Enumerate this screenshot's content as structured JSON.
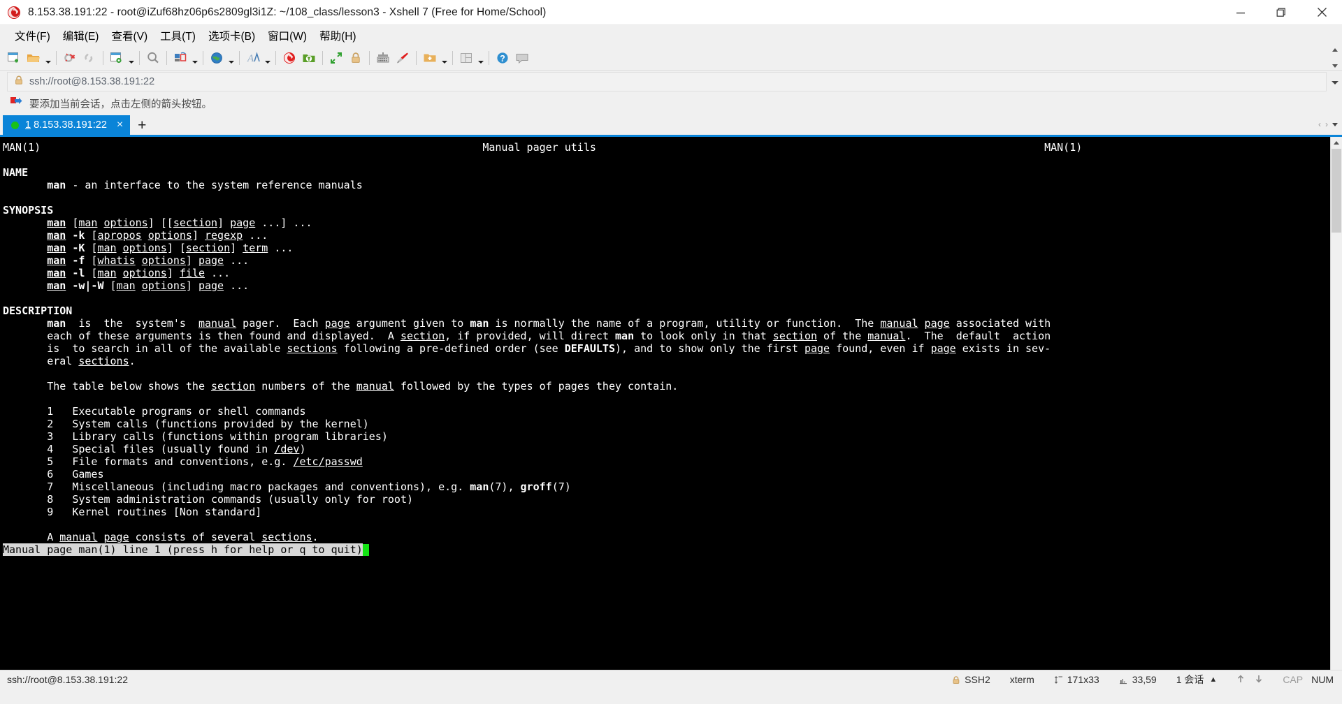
{
  "window": {
    "title": "8.153.38.191:22 - root@iZuf68hz06p6s2809gl3i1Z: ~/108_class/lesson3 - Xshell 7 (Free for Home/School)",
    "logo_icon": "xshell-logo-icon",
    "minimize_label": "Minimize",
    "maximize_label": "Restore",
    "close_label": "Close"
  },
  "menubar": {
    "items": [
      {
        "label": "文件(F)",
        "name": "menu-file"
      },
      {
        "label": "编辑(E)",
        "name": "menu-edit"
      },
      {
        "label": "查看(V)",
        "name": "menu-view"
      },
      {
        "label": "工具(T)",
        "name": "menu-tools"
      },
      {
        "label": "选项卡(B)",
        "name": "menu-tabs"
      },
      {
        "label": "窗口(W)",
        "name": "menu-window"
      },
      {
        "label": "帮助(H)",
        "name": "menu-help"
      }
    ]
  },
  "toolbar": {
    "buttons": [
      {
        "name": "new-session-icon",
        "tooltip": "新建"
      },
      {
        "name": "open-folder-icon",
        "tooltip": "打开"
      },
      {
        "name": "disconnect-icon",
        "tooltip": "断开"
      },
      {
        "name": "reconnect-icon",
        "tooltip": "重新连接"
      },
      {
        "name": "session-properties-icon",
        "tooltip": "属性"
      },
      {
        "name": "find-icon",
        "tooltip": "查找"
      },
      {
        "name": "layout-icon",
        "tooltip": "排列"
      },
      {
        "name": "globe-icon",
        "tooltip": "编码"
      },
      {
        "name": "font-icon",
        "tooltip": "字体"
      },
      {
        "name": "xshell-icon",
        "tooltip": "Xshell"
      },
      {
        "name": "xftp-icon",
        "tooltip": "Xftp"
      },
      {
        "name": "fullscreen-icon",
        "tooltip": "全屏"
      },
      {
        "name": "lock-icon",
        "tooltip": "锁定"
      },
      {
        "name": "keyboard-icon",
        "tooltip": "键盘"
      },
      {
        "name": "highlight-icon",
        "tooltip": "高亮"
      },
      {
        "name": "add-folder-icon",
        "tooltip": "添加"
      },
      {
        "name": "panes-icon",
        "tooltip": "窗格"
      },
      {
        "name": "help-icon",
        "tooltip": "帮助"
      },
      {
        "name": "feedback-icon",
        "tooltip": "反馈"
      }
    ]
  },
  "address_bar": {
    "value": "ssh://root@8.153.38.191:22",
    "lock_icon": "lock-icon",
    "dropdown_icon": "chevron-down-icon"
  },
  "notice": {
    "text": "要添加当前会话，点击左侧的箭头按钮。",
    "icon": "red-arrow-flag-icon"
  },
  "tabs": {
    "items": [
      {
        "number": "1",
        "label": "8.153.38.191:22",
        "status": "connected",
        "close_label": "×"
      }
    ],
    "add_label": "+",
    "scroll_left": "‹",
    "scroll_right": "›"
  },
  "terminal": {
    "header_left": "MAN(1)",
    "header_center": "Manual pager utils",
    "header_right": "MAN(1)",
    "sections": {
      "name_heading": "NAME",
      "name_body": "man - an interface to the system reference manuals",
      "synopsis_heading": "SYNOPSIS",
      "synopsis_lines": [
        "man [man options] [[section] page ...] ...",
        "man -k [apropos options] regexp ...",
        "man -K [man options] [section] term ...",
        "man -f [whatis options] page ...",
        "man -l [man options] file ...",
        "man -w|-W [man options] page ..."
      ],
      "description_heading": "DESCRIPTION",
      "description_paragraph_lines": [
        "man  is  the  system's  manual pager.  Each page argument given to man is normally the name of a program, utility or function.  The manual page associated with",
        "each of these arguments is then found and displayed.  A section, if provided, will direct man to look only in that section of the manual.  The  default  action",
        "is  to search in all of the available sections following a pre-defined order (see DEFAULTS), and to show only the first page found, even if page exists in sev-",
        "eral sections."
      ],
      "table_intro": "The table below shows the section numbers of the manual followed by the types of pages they contain.",
      "table_rows": [
        {
          "num": "1",
          "desc": "Executable programs or shell commands"
        },
        {
          "num": "2",
          "desc": "System calls (functions provided by the kernel)"
        },
        {
          "num": "3",
          "desc": "Library calls (functions within program libraries)"
        },
        {
          "num": "4",
          "desc": "Special files (usually found in /dev)"
        },
        {
          "num": "5",
          "desc": "File formats and conventions, e.g. /etc/passwd"
        },
        {
          "num": "6",
          "desc": "Games"
        },
        {
          "num": "7",
          "desc": "Miscellaneous (including macro packages and conventions), e.g. man(7), groff(7)"
        },
        {
          "num": "8",
          "desc": "System administration commands (usually only for root)"
        },
        {
          "num": "9",
          "desc": "Kernel routines [Non standard]"
        }
      ],
      "closing_line": "A manual page consists of several sections."
    },
    "status_line": "Manual page man(1) line 1 (press h for help or q to quit)",
    "cursor": "block"
  },
  "statusbar": {
    "connection": "ssh://root@8.153.38.191:22",
    "protocol": "SSH2",
    "protocol_icon": "lock-icon",
    "terminal_type": "xterm",
    "size": "171x33",
    "size_icon": "resize-icon",
    "cursor_pos": "33,59",
    "cursor_icon": "position-icon",
    "sessions": "1 会话",
    "sessions_caret": "▲",
    "upload_icon": "arrow-up-icon",
    "download_icon": "arrow-down-icon",
    "caps": "CAP",
    "num": "NUM"
  },
  "colors": {
    "accent": "#0a84d8",
    "terminal_bg": "#000000",
    "terminal_fg": "#ffffff",
    "cursor": "#13e313",
    "status_line_bg": "#d7d7d7",
    "connected_dot": "#19c119",
    "chrome_bg": "#f0f0f0"
  }
}
